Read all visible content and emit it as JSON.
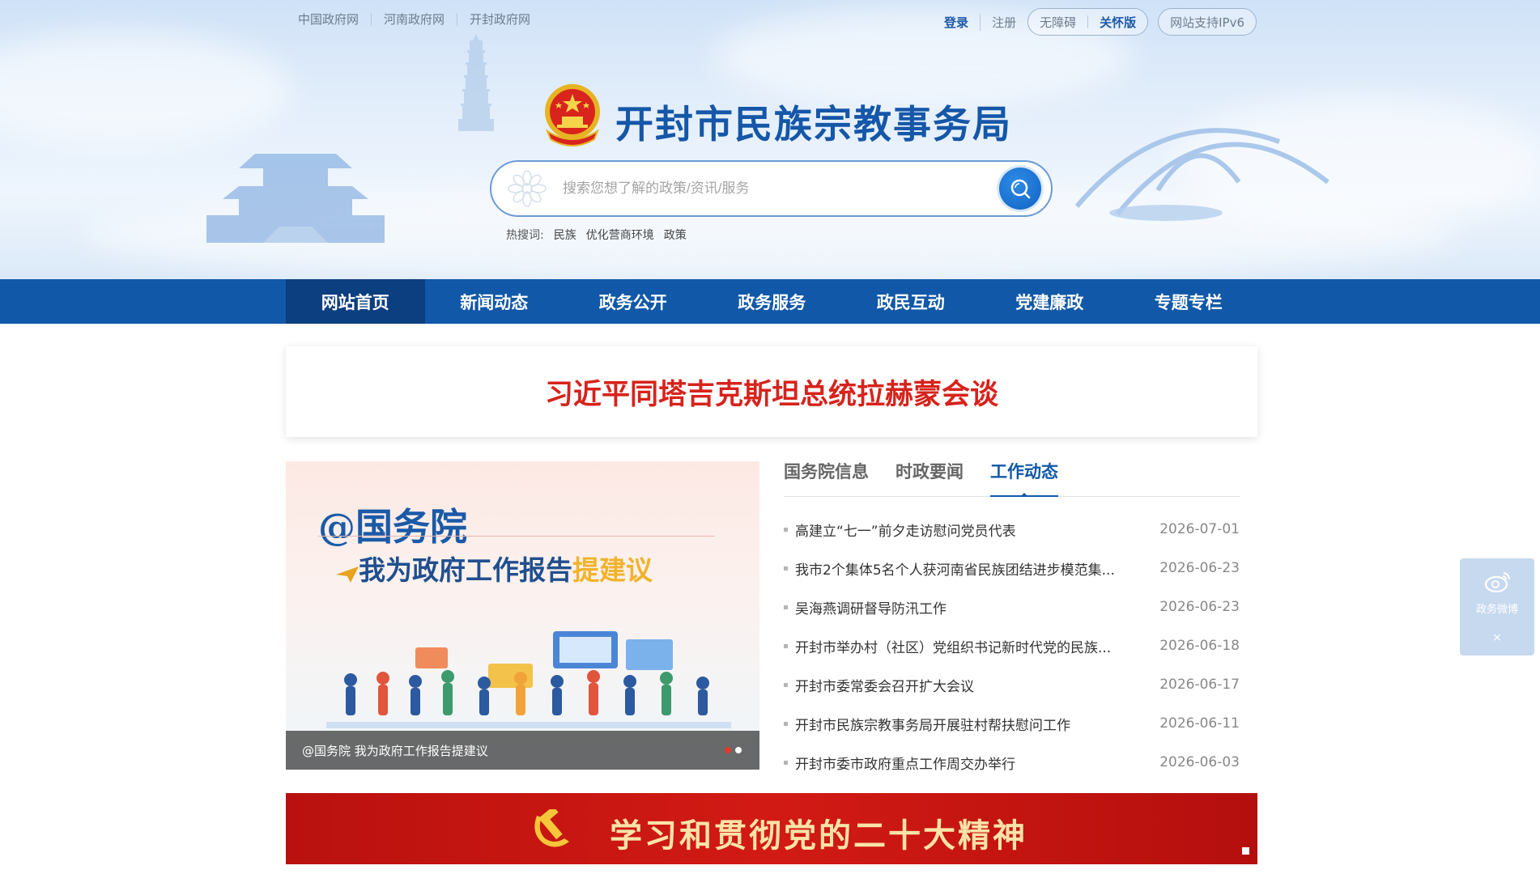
{
  "top_links": [
    "中国政府网",
    "河南政府网",
    "开封政府网"
  ],
  "top_right": {
    "login": "登录",
    "register": "注册",
    "accessible": "无障碍",
    "care_mode": "关怀版",
    "ipv6": "网站支持IPv6"
  },
  "site_title": "开封市民族宗教事务局",
  "search": {
    "placeholder": "搜索您想了解的政策/资讯/服务"
  },
  "hotwords": {
    "label": "热搜词:",
    "words": [
      "民族",
      "优化营商环境",
      "政策"
    ]
  },
  "nav": {
    "items": [
      "网站首页",
      "新闻动态",
      "政务公开",
      "政务服务",
      "政民互动",
      "党建廉政",
      "专题专栏"
    ],
    "active_index": 0
  },
  "headline": "习近平同塔吉克斯坦总统拉赫蒙会谈",
  "carousel": {
    "title": "@国务院",
    "subtitle": "我为政府工作报告",
    "subtitle_em": "提建议",
    "caption": "@国务院 我为政府工作报告提建议",
    "slide_count": 2,
    "active_slide": 0
  },
  "tabs": {
    "items": [
      "国务院信息",
      "时政要闻",
      "工作动态"
    ],
    "active_index": 2
  },
  "news": [
    {
      "title": "高建立“七一”前夕走访慰问党员代表",
      "date": "2026-07-01"
    },
    {
      "title": "我市2个集体5名个人获河南省民族团结进步模范集...",
      "date": "2026-06-23"
    },
    {
      "title": "吴海燕调研督导防汛工作",
      "date": "2026-06-23"
    },
    {
      "title": "开封市举办村（社区）党组织书记新时代党的民族...",
      "date": "2026-06-18"
    },
    {
      "title": "开封市委常委会召开扩大会议",
      "date": "2026-06-17"
    },
    {
      "title": "开封市民族宗教事务局开展驻村帮扶慰问工作",
      "date": "2026-06-11"
    },
    {
      "title": "开封市委市政府重点工作周交办举行",
      "date": "2026-06-03"
    }
  ],
  "banner": {
    "text": "学习和贯彻党的二十大精神"
  },
  "side_float": {
    "label": "政务微博",
    "close": "×"
  },
  "colors": {
    "nav_bg": "#1158a8",
    "nav_active": "#0c3f7f",
    "headline": "#d7231c",
    "title_blue": "#1557a8",
    "banner_red": "#c8150f"
  }
}
